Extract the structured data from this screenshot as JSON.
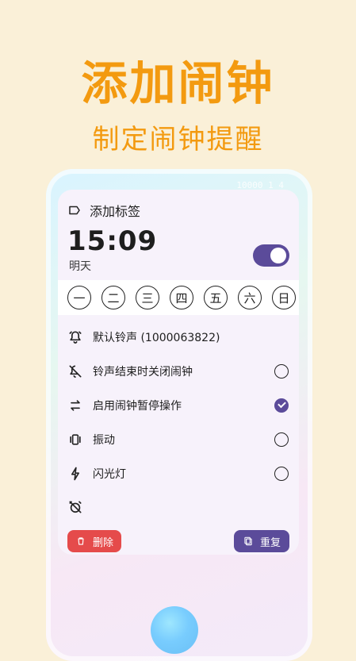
{
  "hero": {
    "title": "添加闹钟",
    "subtitle": "制定闹钟提醒"
  },
  "phone": {
    "top_text": "10000 1 4"
  },
  "alarm": {
    "label_placeholder": "添加标签",
    "time": "15:09",
    "day": "明天",
    "enabled": true,
    "weekdays": [
      "一",
      "二",
      "三",
      "四",
      "五",
      "六",
      "日"
    ],
    "settings": [
      {
        "label": "默认铃声 (1000063822)",
        "icon": "alarm-bell-icon",
        "control": "none"
      },
      {
        "label": "铃声结束时关闭闹钟",
        "icon": "bell-off-icon",
        "control": "radio",
        "checked": false
      },
      {
        "label": "启用闹钟暂停操作",
        "icon": "repeat-icon",
        "control": "radio",
        "checked": true
      },
      {
        "label": "振动",
        "icon": "vibration-icon",
        "control": "radio",
        "checked": false
      },
      {
        "label": "闪光灯",
        "icon": "flash-icon",
        "control": "radio",
        "checked": false
      },
      {
        "label": "",
        "icon": "alarm-off-icon",
        "control": "none"
      }
    ],
    "buttons": {
      "delete": "删除",
      "repeat": "重复"
    }
  },
  "colors": {
    "background": "#FAF0D8",
    "accent_orange": "#F39A10",
    "accent_purple": "#5B4B9A",
    "danger_red": "#E54B4B"
  }
}
